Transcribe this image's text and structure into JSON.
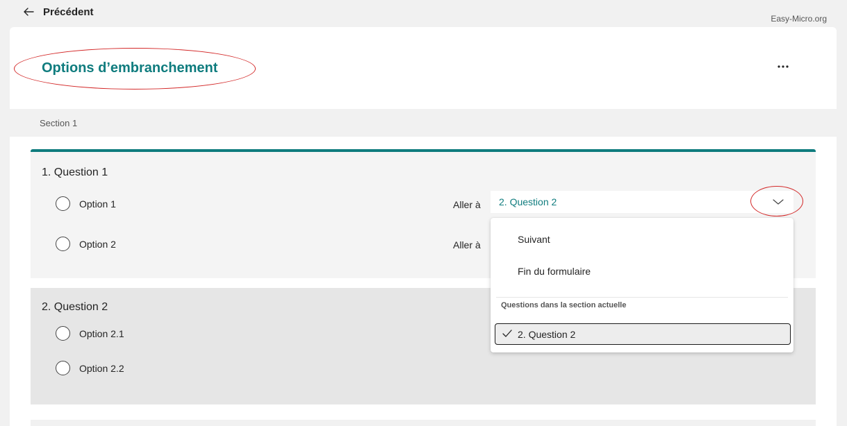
{
  "nav": {
    "back_label": "Précédent"
  },
  "watermark": "Easy-Micro.org",
  "form": {
    "title": "Options d’embranchement",
    "section_label": "Section 1"
  },
  "questions": [
    {
      "title": "1. Question 1",
      "options": [
        {
          "label": "Option 1",
          "goto_label": "Aller à",
          "goto_value": "2. Question 2"
        },
        {
          "label": "Option 2",
          "goto_label": "Aller à"
        }
      ]
    },
    {
      "title": "2. Question 2",
      "options": [
        {
          "label": "Option 2.1"
        },
        {
          "label": "Option 2.2"
        }
      ]
    }
  ],
  "dropdown": {
    "items": [
      "Suivant",
      "Fin du formulaire"
    ],
    "section_header": "Questions dans la section actuelle",
    "selected": "2. Question 2"
  },
  "colors": {
    "accent": "#0f7c7e",
    "annotation": "#d32727"
  },
  "icons": [
    "arrow-left-icon",
    "more-icon",
    "chevron-down-icon",
    "checkmark-icon"
  ]
}
